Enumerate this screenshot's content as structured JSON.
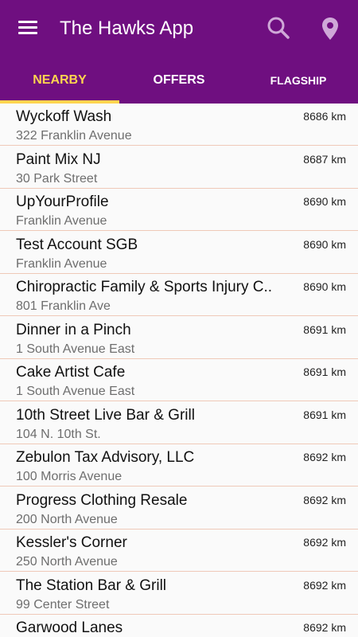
{
  "header": {
    "title": "The Hawks App",
    "menu_icon": "menu-icon",
    "search_icon": "search-icon",
    "location_icon": "map-pin-icon",
    "color": "#6f0f80",
    "accent": "#ffd54f"
  },
  "tabs": [
    {
      "label": "NEARBY",
      "active": true
    },
    {
      "label": "OFFERS",
      "active": false
    },
    {
      "label": "FLAGSHIP",
      "active": false
    }
  ],
  "places": [
    {
      "name": "Wyckoff Wash",
      "address": "322 Franklin Avenue",
      "distance": "8686 km"
    },
    {
      "name": "Paint Mix NJ",
      "address": "30 Park Street",
      "distance": "8687 km"
    },
    {
      "name": "UpYourProfile",
      "address": "Franklin Avenue",
      "distance": "8690 km"
    },
    {
      "name": "Test Account SGB",
      "address": "Franklin Avenue",
      "distance": "8690 km"
    },
    {
      "name": "Chiropractic Family & Sports Injury C..",
      "address": "801 Franklin Ave",
      "distance": "8690 km"
    },
    {
      "name": "Dinner in a Pinch",
      "address": "1 South Avenue East",
      "distance": "8691 km"
    },
    {
      "name": "Cake Artist Cafe",
      "address": "1 South Avenue East",
      "distance": "8691 km"
    },
    {
      "name": "10th Street Live Bar & Grill",
      "address": "104 N. 10th St.",
      "distance": "8691 km"
    },
    {
      "name": "Zebulon Tax Advisory, LLC",
      "address": "100 Morris Avenue",
      "distance": "8692 km"
    },
    {
      "name": "Progress Clothing Resale",
      "address": "200 North Avenue",
      "distance": "8692 km"
    },
    {
      "name": "Kessler's Corner",
      "address": "250 North Avenue",
      "distance": "8692 km"
    },
    {
      "name": "The Station Bar & Grill",
      "address": "99 Center Street",
      "distance": "8692 km"
    },
    {
      "name": "Garwood Lanes",
      "address": "",
      "distance": "8692 km"
    }
  ]
}
